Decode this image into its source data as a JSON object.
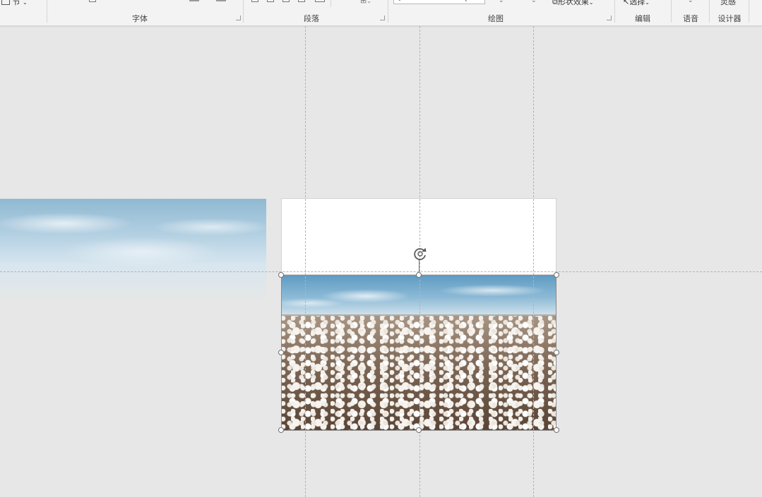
{
  "ribbon": {
    "groups": [
      {
        "id": "font",
        "label": "字体"
      },
      {
        "id": "paragraph",
        "label": "段落"
      },
      {
        "id": "drawing",
        "label": "绘图"
      },
      {
        "id": "editing",
        "label": "编辑"
      },
      {
        "id": "voice",
        "label": "语音"
      },
      {
        "id": "designer",
        "label": "设计器"
      }
    ],
    "section_button": "节",
    "shape_effects": "形状效果",
    "select_button": "选择",
    "ideas_button": "灵感"
  },
  "colors": {
    "canvas_bg": "#e6e7e6",
    "ribbon_bg": "#f3f3f3",
    "guide": "#b3b3b3",
    "handle_border": "#6f6f6f"
  }
}
